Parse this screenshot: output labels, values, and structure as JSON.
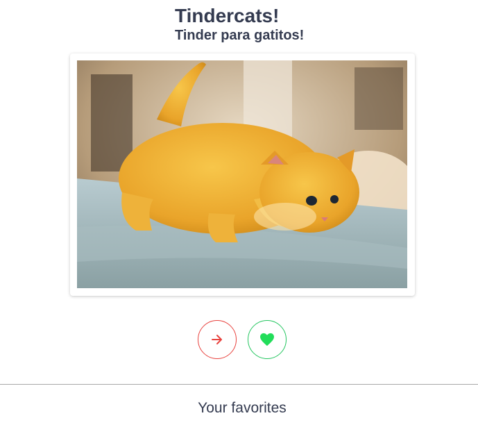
{
  "header": {
    "title": "Tindercats!",
    "subtitle": "Tinder para gatitos!"
  },
  "card": {
    "image_icon": "kitten-photo"
  },
  "actions": {
    "next_icon": "arrow-right-icon",
    "next_color": "#e8413d",
    "favorite_icon": "heart-icon",
    "favorite_color": "#22c55e"
  },
  "favorites": {
    "label": "Your favorites"
  }
}
